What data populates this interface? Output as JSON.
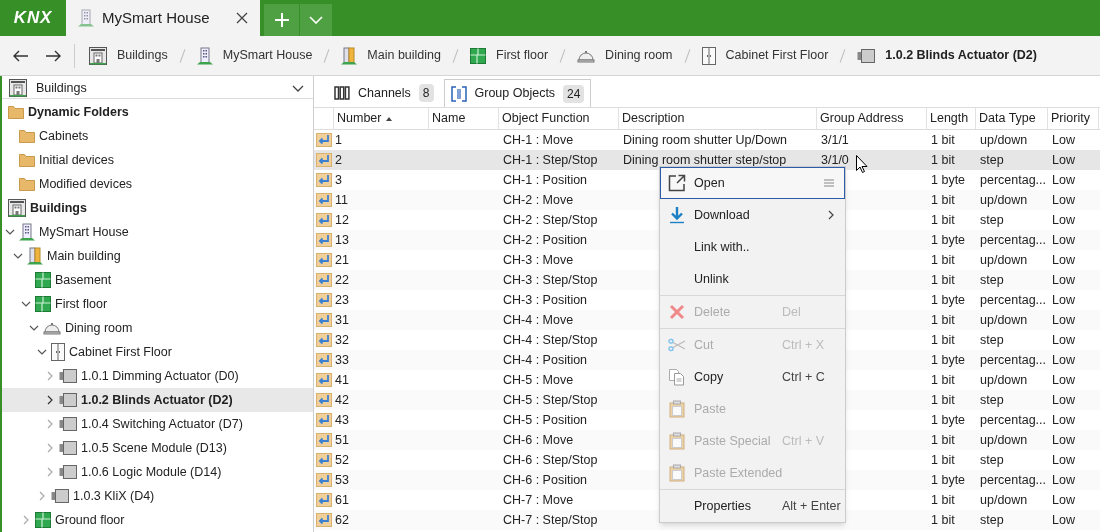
{
  "app": {
    "logo": "KNX"
  },
  "document_tab": {
    "title": "MySmart House"
  },
  "breadcrumbs": [
    {
      "label": "Buildings",
      "kind": "buildings",
      "selected": false
    },
    {
      "label": "MySmart House",
      "kind": "building",
      "selected": false
    },
    {
      "label": "Main building",
      "kind": "building-part",
      "selected": false
    },
    {
      "label": "First floor",
      "kind": "floor",
      "selected": false
    },
    {
      "label": "Dining room",
      "kind": "room",
      "selected": false
    },
    {
      "label": "Cabinet First Floor",
      "kind": "cabinet",
      "selected": false
    },
    {
      "label": "1.0.2 Blinds Actuator (D2)",
      "kind": "device",
      "selected": true
    }
  ],
  "tree_panel": {
    "header": {
      "label": "Buildings",
      "kind": "buildings"
    },
    "items": [
      {
        "label": "Dynamic Folders",
        "kind": "folder",
        "selected": false,
        "children": [
          {
            "label": "Cabinets",
            "kind": "folder",
            "selected": false
          },
          {
            "label": "Initial devices",
            "kind": "folder",
            "selected": false
          },
          {
            "label": "Modified devices",
            "kind": "folder",
            "selected": false
          }
        ]
      },
      {
        "label": "Buildings",
        "kind": "buildings",
        "selected": false,
        "children": [
          {
            "label": "MySmart House",
            "kind": "building",
            "expanded": true,
            "selected": false,
            "children": [
              {
                "label": "Main building",
                "kind": "building-part",
                "expanded": true,
                "selected": false,
                "children": [
                  {
                    "label": "Basement",
                    "kind": "floor",
                    "selected": false
                  },
                  {
                    "label": "First floor",
                    "kind": "floor",
                    "expanded": true,
                    "selected": false,
                    "children": [
                      {
                        "label": "Dining room",
                        "kind": "room",
                        "expanded": true,
                        "selected": false,
                        "children": [
                          {
                            "label": "Cabinet First Floor",
                            "kind": "cabinet",
                            "expanded": true,
                            "selected": false,
                            "children": [
                              {
                                "label": "1.0.1 Dimming Actuator (D0)",
                                "kind": "device",
                                "expanded": false,
                                "selected": false
                              },
                              {
                                "label": "1.0.2 Blinds Actuator (D2)",
                                "kind": "device",
                                "expanded": false,
                                "selected": true
                              },
                              {
                                "label": "1.0.4 Switching Actuator (D7)",
                                "kind": "device",
                                "expanded": false,
                                "selected": false
                              },
                              {
                                "label": "1.0.5 Scene Module (D13)",
                                "kind": "device",
                                "expanded": false,
                                "selected": false
                              },
                              {
                                "label": "1.0.6 Logic Module (D14)",
                                "kind": "device",
                                "expanded": false,
                                "selected": false
                              }
                            ]
                          },
                          {
                            "label": "1.0.3 KliX (D4)",
                            "kind": "device",
                            "expanded": false,
                            "selected": false
                          }
                        ]
                      }
                    ]
                  },
                  {
                    "label": "Ground floor",
                    "kind": "floor",
                    "expanded": false,
                    "selected": false
                  }
                ]
              }
            ]
          }
        ]
      }
    ]
  },
  "view_tabs": [
    {
      "label": "Channels",
      "count": "8",
      "kind": "channels",
      "selected": false
    },
    {
      "label": "Group Objects",
      "count": "24",
      "kind": "group-objects",
      "selected": true
    }
  ],
  "table": {
    "columns": [
      {
        "label": "Number",
        "sorted": true
      },
      {
        "label": "Name",
        "sorted": false
      },
      {
        "label": "Object Function",
        "sorted": false
      },
      {
        "label": "Description",
        "sorted": false
      },
      {
        "label": "Group Address",
        "sorted": false
      },
      {
        "label": "Length",
        "sorted": false
      },
      {
        "label": "Data Type",
        "sorted": false
      },
      {
        "label": "Priority",
        "sorted": false
      }
    ],
    "rows": [
      {
        "number": "1",
        "object_function": "CH-1 : Move",
        "description": "Dining room shutter Up/Down",
        "group_address": "3/1/1",
        "length": "1 bit",
        "data_type": "up/down",
        "priority": "Low",
        "selected": false
      },
      {
        "number": "2",
        "object_function": "CH-1 : Step/Stop",
        "description": "Dining room shutter step/stop",
        "group_address": "3/1/0",
        "length": "1 bit",
        "data_type": "step",
        "priority": "Low",
        "selected": true
      },
      {
        "number": "3",
        "object_function": "CH-1 : Position",
        "length": "1 byte",
        "data_type": "percentag...",
        "priority": "Low",
        "selected": false
      },
      {
        "number": "11",
        "object_function": "CH-2 : Move",
        "length": "1 bit",
        "data_type": "up/down",
        "priority": "Low",
        "selected": false
      },
      {
        "number": "12",
        "object_function": "CH-2 : Step/Stop",
        "length": "1 bit",
        "data_type": "step",
        "priority": "Low",
        "selected": false
      },
      {
        "number": "13",
        "object_function": "CH-2 : Position",
        "length": "1 byte",
        "data_type": "percentag...",
        "priority": "Low",
        "selected": false
      },
      {
        "number": "21",
        "object_function": "CH-3 : Move",
        "length": "1 bit",
        "data_type": "up/down",
        "priority": "Low",
        "selected": false
      },
      {
        "number": "22",
        "object_function": "CH-3 : Step/Stop",
        "length": "1 bit",
        "data_type": "step",
        "priority": "Low",
        "selected": false
      },
      {
        "number": "23",
        "object_function": "CH-3 : Position",
        "length": "1 byte",
        "data_type": "percentag...",
        "priority": "Low",
        "selected": false
      },
      {
        "number": "31",
        "object_function": "CH-4 : Move",
        "length": "1 bit",
        "data_type": "up/down",
        "priority": "Low",
        "selected": false
      },
      {
        "number": "32",
        "object_function": "CH-4 : Step/Stop",
        "length": "1 bit",
        "data_type": "step",
        "priority": "Low",
        "selected": false
      },
      {
        "number": "33",
        "object_function": "CH-4 : Position",
        "length": "1 byte",
        "data_type": "percentag...",
        "priority": "Low",
        "selected": false
      },
      {
        "number": "41",
        "object_function": "CH-5 : Move",
        "length": "1 bit",
        "data_type": "up/down",
        "priority": "Low",
        "selected": false
      },
      {
        "number": "42",
        "object_function": "CH-5 : Step/Stop",
        "length": "1 bit",
        "data_type": "step",
        "priority": "Low",
        "selected": false
      },
      {
        "number": "43",
        "object_function": "CH-5 : Position",
        "length": "1 byte",
        "data_type": "percentag...",
        "priority": "Low",
        "selected": false
      },
      {
        "number": "51",
        "object_function": "CH-6 : Move",
        "length": "1 bit",
        "data_type": "up/down",
        "priority": "Low",
        "selected": false
      },
      {
        "number": "52",
        "object_function": "CH-6 : Step/Stop",
        "length": "1 bit",
        "data_type": "step",
        "priority": "Low",
        "selected": false
      },
      {
        "number": "53",
        "object_function": "CH-6 : Position",
        "length": "1 byte",
        "data_type": "percentag...",
        "priority": "Low",
        "selected": false
      },
      {
        "number": "61",
        "object_function": "CH-7 : Move",
        "length": "1 bit",
        "data_type": "up/down",
        "priority": "Low",
        "selected": false
      },
      {
        "number": "62",
        "object_function": "CH-7 : Step/Stop",
        "length": "1 bit",
        "data_type": "step",
        "priority": "Low",
        "selected": false
      }
    ]
  },
  "context_menu": {
    "groups": [
      [
        {
          "label": "Open",
          "kind": "open",
          "focused": true,
          "disabled": false,
          "submenu": false
        },
        {
          "label": "Download",
          "kind": "download",
          "focused": false,
          "disabled": false,
          "submenu": true
        },
        {
          "label": "Link with..",
          "kind": "none",
          "focused": false,
          "disabled": false,
          "submenu": false
        },
        {
          "label": "Unlink",
          "kind": "none",
          "focused": false,
          "disabled": false,
          "submenu": false
        }
      ],
      [
        {
          "label": "Delete",
          "shortcut": "Del",
          "kind": "delete",
          "focused": false,
          "disabled": true,
          "submenu": false
        }
      ],
      [
        {
          "label": "Cut",
          "shortcut": "Ctrl + X",
          "kind": "cut",
          "focused": false,
          "disabled": true,
          "submenu": false
        },
        {
          "label": "Copy",
          "shortcut": "Ctrl + C",
          "kind": "copy",
          "focused": false,
          "disabled": false,
          "submenu": false
        },
        {
          "label": "Paste",
          "kind": "paste",
          "focused": false,
          "disabled": true,
          "submenu": false
        },
        {
          "label": "Paste Special",
          "shortcut": "Ctrl + V",
          "kind": "paste",
          "focused": false,
          "disabled": true,
          "submenu": false
        },
        {
          "label": "Paste Extended",
          "kind": "paste",
          "focused": false,
          "disabled": true,
          "submenu": false
        }
      ],
      [
        {
          "label": "Properties",
          "shortcut": "Alt + Enter",
          "kind": "none",
          "focused": false,
          "disabled": false,
          "submenu": false
        }
      ]
    ]
  }
}
